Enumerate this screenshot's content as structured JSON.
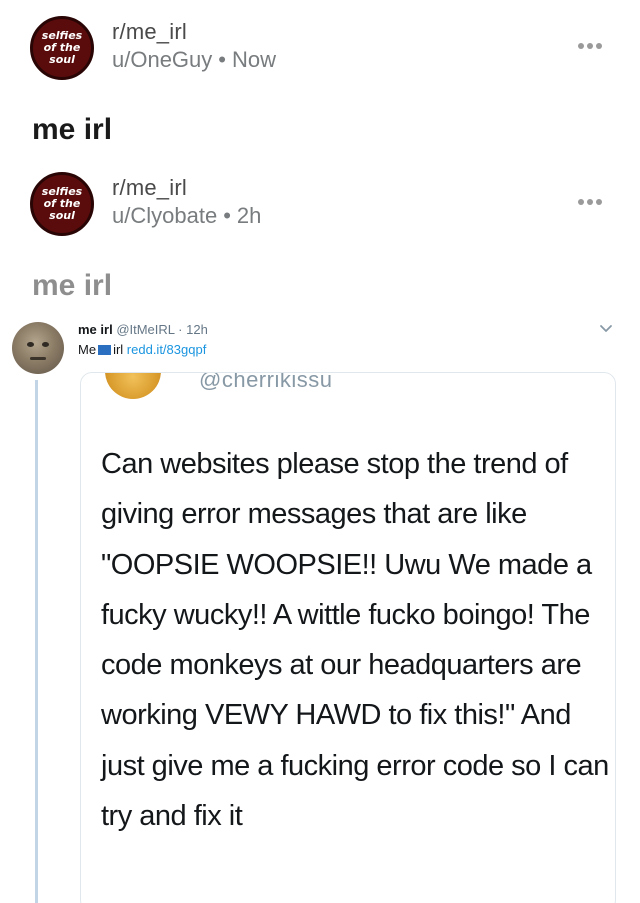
{
  "posts": [
    {
      "badge_lines": [
        "selfies",
        "of the",
        "soul"
      ],
      "subreddit": "r/me_irl",
      "user": "u/OneGuy",
      "time": "Now",
      "title": "me irl"
    },
    {
      "badge_lines": [
        "selfies",
        "of the",
        "soul"
      ],
      "subreddit": "r/me_irl",
      "user": "u/Clyobate",
      "time": "2h",
      "title": "me irl"
    }
  ],
  "separator_dot": "•",
  "tweet": {
    "name": "me irl",
    "handle": "@ItMeIRL",
    "separator": "·",
    "time": "12h",
    "text_before": "Me",
    "text_after": "irl",
    "link": "redd.it/83gqpf",
    "quote": {
      "handle": "@cherrikissu",
      "body": "Can websites please stop the trend of giving error messages that are like \"OOPSIE WOOPSIE!! Uwu We made a fucky wucky!! A wittle fucko boingo! The code monkeys at our headquarters are working VEWY HAWD to fix this!\" And just give me a fucking error code so I can try and fix it"
    }
  },
  "icons": {
    "badge": "subreddit-badge-icon",
    "more": "more-options-icon",
    "chevron": "chevron-down-icon",
    "emoji": "laptop-emoji-icon"
  },
  "colors": {
    "badge_bg": "#5a0c0c",
    "link": "#1b95e0",
    "thread_line": "#c2d5e6"
  }
}
